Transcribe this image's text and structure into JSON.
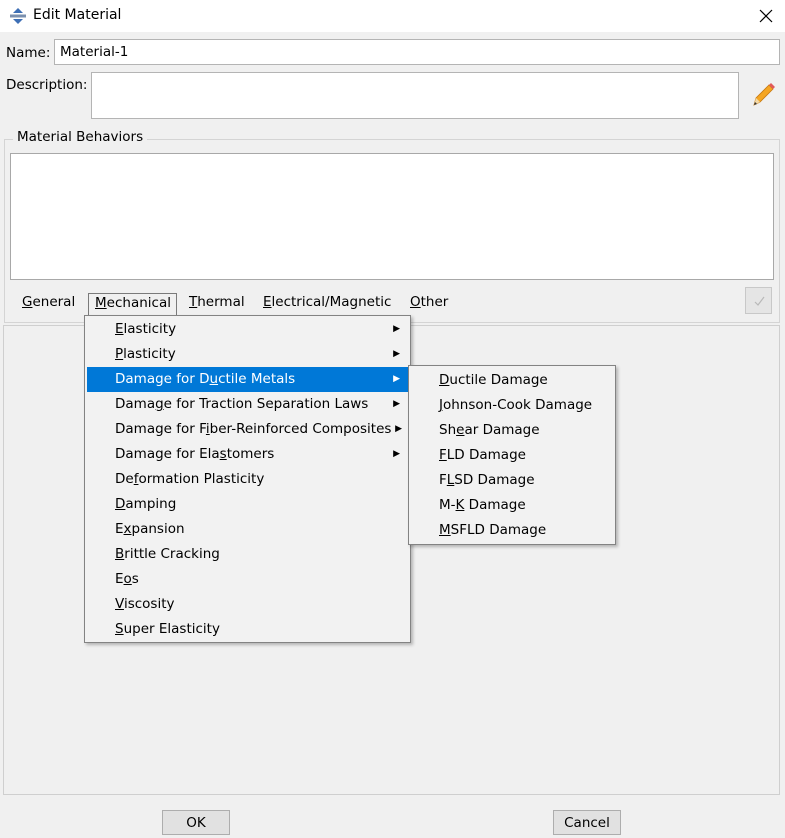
{
  "window": {
    "title": "Edit Material",
    "close_icon": "close-icon",
    "app_icon": "abaqus-icon"
  },
  "form": {
    "name_label": "Name:",
    "name_value": "Material-1",
    "description_label": "Description:",
    "description_value": ""
  },
  "behaviors": {
    "group_title": "Material Behaviors"
  },
  "menubar": [
    {
      "pre": "",
      "ul": "G",
      "post": "eneral"
    },
    {
      "pre": "",
      "ul": "M",
      "post": "echanical"
    },
    {
      "pre": "",
      "ul": "T",
      "post": "hermal"
    },
    {
      "pre": "",
      "ul": "E",
      "post": "lectrical/Magnetic"
    },
    {
      "pre": "",
      "ul": "O",
      "post": "ther"
    }
  ],
  "main_menu": [
    {
      "pre": "",
      "ul": "E",
      "post": "lasticity",
      "submenu": true
    },
    {
      "pre": "",
      "ul": "P",
      "post": "lasticity",
      "submenu": true
    },
    {
      "pre": "Damage for D",
      "ul": "u",
      "post": "ctile Metals",
      "submenu": true,
      "highlighted": true
    },
    {
      "pre": "Dama",
      "ul": "g",
      "post": "e for Traction Separation Laws",
      "submenu": true
    },
    {
      "pre": "Damage for F",
      "ul": "i",
      "post": "ber-Reinforced Composites",
      "submenu": true
    },
    {
      "pre": "Damage for Ela",
      "ul": "s",
      "post": "tomers",
      "submenu": true
    },
    {
      "pre": "De",
      "ul": "f",
      "post": "ormation Plasticity",
      "submenu": false
    },
    {
      "pre": "",
      "ul": "D",
      "post": "amping",
      "submenu": false
    },
    {
      "pre": "E",
      "ul": "x",
      "post": "pansion",
      "submenu": false
    },
    {
      "pre": "",
      "ul": "B",
      "post": "rittle Cracking",
      "submenu": false
    },
    {
      "pre": "E",
      "ul": "o",
      "post": "s",
      "submenu": false
    },
    {
      "pre": "",
      "ul": "V",
      "post": "iscosity",
      "submenu": false
    },
    {
      "pre": "",
      "ul": "S",
      "post": "uper Elasticity",
      "submenu": false
    }
  ],
  "sub_menu": [
    {
      "pre": "",
      "ul": "D",
      "post": "uctile Damage"
    },
    {
      "pre": "",
      "ul": "J",
      "post": "ohnson-Cook Damage"
    },
    {
      "pre": "Sh",
      "ul": "e",
      "post": "ar Damage"
    },
    {
      "pre": "",
      "ul": "F",
      "post": "LD Damage"
    },
    {
      "pre": "F",
      "ul": "L",
      "post": "SD Damage"
    },
    {
      "pre": "M-",
      "ul": "K",
      "post": " Damage"
    },
    {
      "pre": "",
      "ul": "M",
      "post": "SFLD Damage"
    }
  ],
  "buttons": {
    "ok": "OK",
    "cancel": "Cancel"
  },
  "colors": {
    "highlight": "#0078d7",
    "dialog_bg": "#f0f0f0"
  }
}
